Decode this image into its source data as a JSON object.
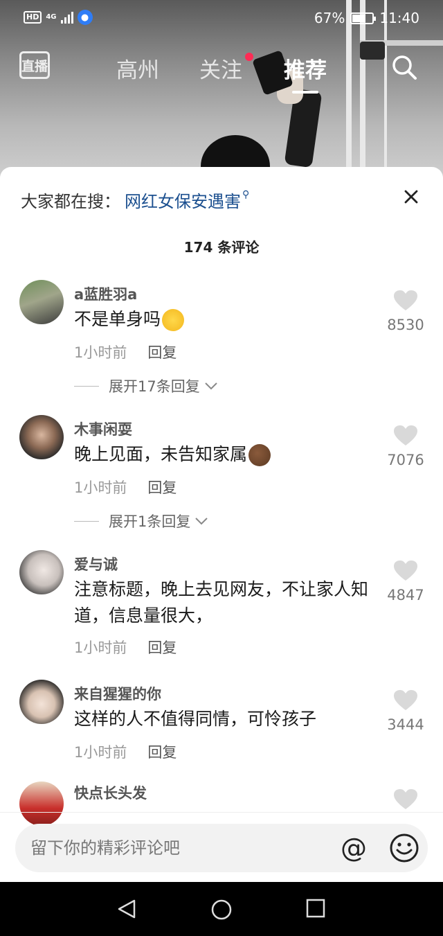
{
  "status_bar": {
    "hd": "HD",
    "network": "4G",
    "battery_percent": "67%",
    "battery_level": 0.67,
    "time": "11:40"
  },
  "top_nav": {
    "live_label": "直播",
    "tabs": [
      {
        "label": "高州"
      },
      {
        "label": "关注"
      },
      {
        "label": "推荐"
      }
    ],
    "active_tab": "推荐"
  },
  "sheet": {
    "hot_search_prefix": "大家都在搜：",
    "hot_search_term": "网红女保安遇害",
    "comment_count": "174 条评论"
  },
  "comments": [
    {
      "user": "a蓝胜羽a",
      "text": "不是单身吗",
      "emoji": "pleading-face",
      "time": "1小时前",
      "reply": "回复",
      "likes": "8530",
      "expand": "展开17条回复"
    },
    {
      "user": "木事闲耍",
      "text": "晚上见面，未告知家属",
      "emoji": "cookie",
      "time": "1小时前",
      "reply": "回复",
      "likes": "7076",
      "expand": "展开1条回复"
    },
    {
      "user": "爱与诚",
      "text": "注意标题，晚上去见网友，不让家人知道，信息量很大，",
      "time": "1小时前",
      "reply": "回复",
      "likes": "4847"
    },
    {
      "user": "来自猩猩的你",
      "text": "这样的人不值得同情，可怜孩子",
      "time": "1小时前",
      "reply": "回复",
      "likes": "3444"
    },
    {
      "user": "快点长头发",
      "text": "",
      "time": "",
      "reply": "",
      "likes": ""
    }
  ],
  "input": {
    "placeholder": "留下你的精彩评论吧"
  },
  "colors": {
    "accent_red": "#ff2b55",
    "hot_search_link": "#1b4f8f",
    "sheet_bg": "#ffffff",
    "input_bg": "#f2f2f2"
  }
}
